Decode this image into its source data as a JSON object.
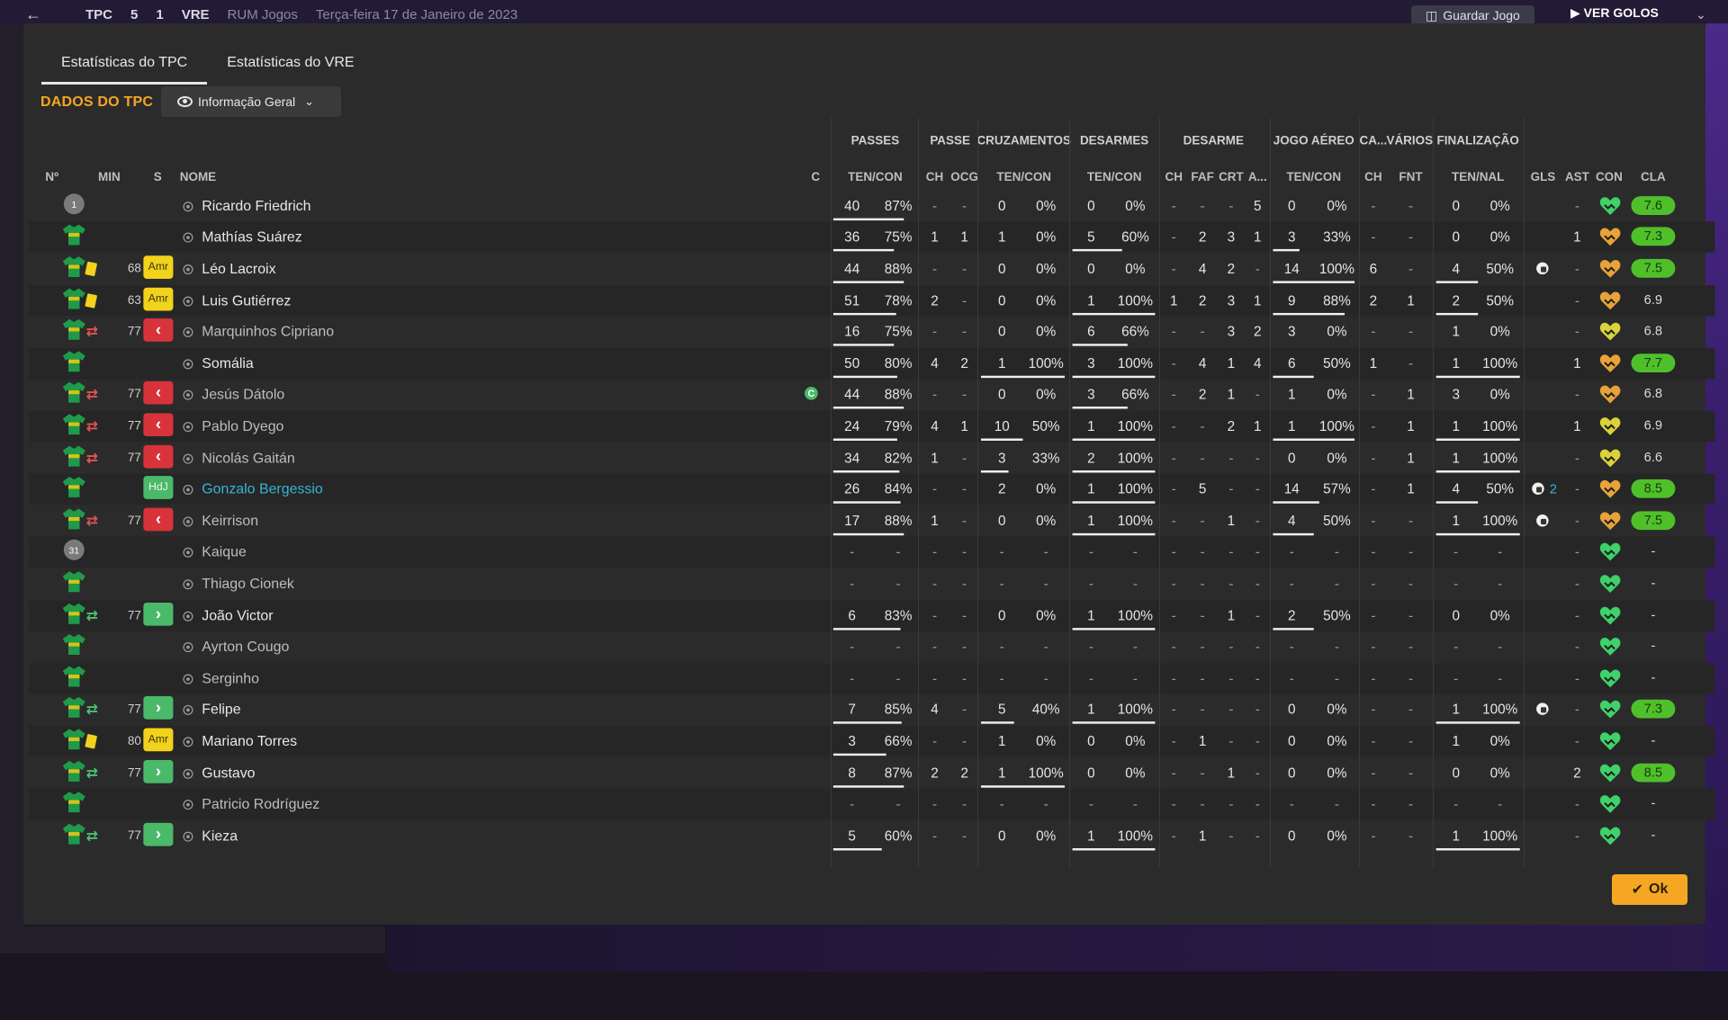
{
  "background": {
    "match_score": [
      "TPC",
      "5",
      "1",
      "VRE"
    ],
    "status": "RUM Jogos",
    "date": "Terça-feira 17 de Janeiro de 2023",
    "save_label": "Guardar Jogo",
    "goals_label": "VER GOLOS"
  },
  "tabs": [
    "Estatísticas do TPC",
    "Estatísticas do VRE"
  ],
  "section_title": "DADOS DO TPC",
  "view_dropdown": "Informação Geral",
  "group_headers": [
    "PASSES",
    "PASSE",
    "CRUZAMENTOS",
    "DESARMES",
    "DESARME",
    "JOGO AÉREO",
    "CA...",
    "VÁRIOS",
    "FINALIZAÇÃO"
  ],
  "col_headers": {
    "num": "Nº",
    "min": "MIN",
    "s": "S",
    "name": "NOME",
    "c": "C",
    "passes": "TEN/CON",
    "ch1": "CH",
    "ocg": "OCG",
    "cruz": "TEN/CON",
    "des": "TEN/CON",
    "ch2": "CH",
    "faf": "FAF",
    "crt": "CRT",
    "a": "A...",
    "aereo": "TEN/CON",
    "ch3": "CH",
    "fnt": "FNT",
    "fin": "TEN/NAL",
    "gls": "GLS",
    "ast": "AST",
    "con": "CON",
    "cla": "CLA"
  },
  "ok_label": "Ok",
  "colors": {
    "accent": "#f5a623",
    "rating_high": "#4fc02a",
    "sub_out": "#d8333a",
    "sub_in": "#4ab96a",
    "potm": "#35b5d5"
  },
  "players": [
    {
      "shirt": "gk",
      "num": "1",
      "icon": "",
      "min": "",
      "s": "",
      "name": "Ricardo Friedrich",
      "style": "",
      "c": "",
      "p": [
        "40",
        "87%"
      ],
      "ch1": "-",
      "ocg": "-",
      "cz": [
        "0",
        "0%"
      ],
      "ds": [
        "0",
        "0%"
      ],
      "ch2": "-",
      "faf": "-",
      "crt": "-",
      "a": "5",
      "ae": [
        "0",
        "0%"
      ],
      "ch3": "-",
      "fnt": "-",
      "fn": [
        "0",
        "0%"
      ],
      "gls": "",
      "ast": "-",
      "heart": "green",
      "cla": "7.6"
    },
    {
      "shirt": "out",
      "num": "",
      "icon": "",
      "min": "",
      "s": "",
      "name": "Mathías Suárez",
      "style": "",
      "c": "",
      "p": [
        "36",
        "75%"
      ],
      "ch1": "1",
      "ocg": "1",
      "cz": [
        "1",
        "0%"
      ],
      "ds": [
        "5",
        "60%"
      ],
      "ch2": "-",
      "faf": "2",
      "crt": "3",
      "a": "1",
      "ae": [
        "3",
        "33%"
      ],
      "ch3": "-",
      "fnt": "-",
      "fn": [
        "0",
        "0%"
      ],
      "gls": "",
      "ast": "1",
      "heart": "orange",
      "cla": "7.3"
    },
    {
      "shirt": "out",
      "num": "",
      "icon": "card",
      "min": "68",
      "s": "Amr",
      "name": "Léo Lacroix",
      "style": "",
      "c": "",
      "p": [
        "44",
        "88%"
      ],
      "ch1": "-",
      "ocg": "-",
      "cz": [
        "0",
        "0%"
      ],
      "ds": [
        "0",
        "0%"
      ],
      "ch2": "-",
      "faf": "4",
      "crt": "2",
      "a": "-",
      "ae": [
        "14",
        "100%"
      ],
      "ch3": "6",
      "fnt": "-",
      "fn": [
        "4",
        "50%"
      ],
      "gls": "ball",
      "ast": "-",
      "heart": "orange",
      "cla": "7.5"
    },
    {
      "shirt": "out",
      "num": "",
      "icon": "card",
      "min": "63",
      "s": "Amr",
      "name": "Luis Gutiérrez",
      "style": "",
      "c": "",
      "p": [
        "51",
        "78%"
      ],
      "ch1": "2",
      "ocg": "-",
      "cz": [
        "0",
        "0%"
      ],
      "ds": [
        "1",
        "100%"
      ],
      "ch2": "1",
      "faf": "2",
      "crt": "3",
      "a": "1",
      "ae": [
        "9",
        "88%"
      ],
      "ch3": "2",
      "fnt": "1",
      "fn": [
        "2",
        "50%"
      ],
      "gls": "",
      "ast": "-",
      "heart": "orange",
      "cla": "6.9"
    },
    {
      "shirt": "out",
      "num": "",
      "icon": "out",
      "min": "77",
      "s": "out",
      "name": "Marquinhos Cipriano",
      "style": "sub",
      "c": "",
      "p": [
        "16",
        "75%"
      ],
      "ch1": "-",
      "ocg": "-",
      "cz": [
        "0",
        "0%"
      ],
      "ds": [
        "6",
        "66%"
      ],
      "ch2": "-",
      "faf": "-",
      "crt": "3",
      "a": "2",
      "ae": [
        "3",
        "0%"
      ],
      "ch3": "-",
      "fnt": "-",
      "fn": [
        "1",
        "0%"
      ],
      "gls": "",
      "ast": "-",
      "heart": "yellow",
      "cla": "6.8"
    },
    {
      "shirt": "out",
      "num": "",
      "icon": "",
      "min": "",
      "s": "",
      "name": "Somália",
      "style": "",
      "c": "",
      "p": [
        "50",
        "80%"
      ],
      "ch1": "4",
      "ocg": "2",
      "cz": [
        "1",
        "100%"
      ],
      "ds": [
        "3",
        "100%"
      ],
      "ch2": "-",
      "faf": "4",
      "crt": "1",
      "a": "4",
      "ae": [
        "6",
        "50%"
      ],
      "ch3": "1",
      "fnt": "-",
      "fn": [
        "1",
        "100%"
      ],
      "gls": "",
      "ast": "1",
      "heart": "orange",
      "cla": "7.7"
    },
    {
      "shirt": "out",
      "num": "",
      "icon": "out",
      "min": "77",
      "s": "out",
      "name": "Jesús Dátolo",
      "style": "sub",
      "c": "C",
      "p": [
        "44",
        "88%"
      ],
      "ch1": "-",
      "ocg": "-",
      "cz": [
        "0",
        "0%"
      ],
      "ds": [
        "3",
        "66%"
      ],
      "ch2": "-",
      "faf": "2",
      "crt": "1",
      "a": "-",
      "ae": [
        "1",
        "0%"
      ],
      "ch3": "-",
      "fnt": "1",
      "fn": [
        "3",
        "0%"
      ],
      "gls": "",
      "ast": "-",
      "heart": "orange",
      "cla": "6.8"
    },
    {
      "shirt": "out",
      "num": "",
      "icon": "out",
      "min": "77",
      "s": "out",
      "name": "Pablo Dyego",
      "style": "sub",
      "c": "",
      "p": [
        "24",
        "79%"
      ],
      "ch1": "4",
      "ocg": "1",
      "cz": [
        "10",
        "50%"
      ],
      "ds": [
        "1",
        "100%"
      ],
      "ch2": "-",
      "faf": "-",
      "crt": "2",
      "a": "1",
      "ae": [
        "1",
        "100%"
      ],
      "ch3": "-",
      "fnt": "1",
      "fn": [
        "1",
        "100%"
      ],
      "gls": "",
      "ast": "1",
      "heart": "yellow",
      "cla": "6.9"
    },
    {
      "shirt": "out",
      "num": "",
      "icon": "out",
      "min": "77",
      "s": "out",
      "name": "Nicolás Gaitán",
      "style": "sub",
      "c": "",
      "p": [
        "34",
        "82%"
      ],
      "ch1": "1",
      "ocg": "-",
      "cz": [
        "3",
        "33%"
      ],
      "ds": [
        "2",
        "100%"
      ],
      "ch2": "-",
      "faf": "-",
      "crt": "-",
      "a": "-",
      "ae": [
        "0",
        "0%"
      ],
      "ch3": "-",
      "fnt": "1",
      "fn": [
        "1",
        "100%"
      ],
      "gls": "",
      "ast": "-",
      "heart": "yellow",
      "cla": "6.6"
    },
    {
      "shirt": "out",
      "num": "",
      "icon": "",
      "min": "",
      "s": "HdJ",
      "name": "Gonzalo Bergessio",
      "style": "potm",
      "c": "",
      "p": [
        "26",
        "84%"
      ],
      "ch1": "-",
      "ocg": "-",
      "cz": [
        "2",
        "0%"
      ],
      "ds": [
        "1",
        "100%"
      ],
      "ch2": "-",
      "faf": "5",
      "crt": "-",
      "a": "-",
      "ae": [
        "14",
        "57%"
      ],
      "ch3": "-",
      "fnt": "1",
      "fn": [
        "4",
        "50%"
      ],
      "gls": "ball2",
      "ast": "-",
      "heart": "orange",
      "cla": "8.5"
    },
    {
      "shirt": "out",
      "num": "",
      "icon": "out",
      "min": "77",
      "s": "out",
      "name": "Keirrison",
      "style": "sub",
      "c": "",
      "p": [
        "17",
        "88%"
      ],
      "ch1": "1",
      "ocg": "-",
      "cz": [
        "0",
        "0%"
      ],
      "ds": [
        "1",
        "100%"
      ],
      "ch2": "-",
      "faf": "-",
      "crt": "1",
      "a": "-",
      "ae": [
        "4",
        "50%"
      ],
      "ch3": "-",
      "fnt": "-",
      "fn": [
        "1",
        "100%"
      ],
      "gls": "ball",
      "ast": "-",
      "heart": "orange",
      "cla": "7.5"
    },
    {
      "shirt": "gk",
      "num": "31",
      "icon": "",
      "min": "",
      "s": "",
      "name": "Kaique",
      "style": "sub",
      "c": "",
      "p": [
        "-",
        "-"
      ],
      "ch1": "-",
      "ocg": "-",
      "cz": [
        "-",
        "-"
      ],
      "ds": [
        "-",
        "-"
      ],
      "ch2": "-",
      "faf": "-",
      "crt": "-",
      "a": "-",
      "ae": [
        "-",
        "-"
      ],
      "ch3": "-",
      "fnt": "-",
      "fn": [
        "-",
        "-"
      ],
      "gls": "",
      "ast": "-",
      "heart": "green",
      "cla": "-"
    },
    {
      "shirt": "out",
      "num": "",
      "icon": "",
      "min": "",
      "s": "",
      "name": "Thiago Cionek",
      "style": "sub",
      "c": "",
      "p": [
        "-",
        "-"
      ],
      "ch1": "-",
      "ocg": "-",
      "cz": [
        "-",
        "-"
      ],
      "ds": [
        "-",
        "-"
      ],
      "ch2": "-",
      "faf": "-",
      "crt": "-",
      "a": "-",
      "ae": [
        "-",
        "-"
      ],
      "ch3": "-",
      "fnt": "-",
      "fn": [
        "-",
        "-"
      ],
      "gls": "",
      "ast": "-",
      "heart": "green",
      "cla": "-"
    },
    {
      "shirt": "out",
      "num": "",
      "icon": "in",
      "min": "77",
      "s": "in",
      "name": "João Victor",
      "style": "",
      "c": "",
      "p": [
        "6",
        "83%"
      ],
      "ch1": "-",
      "ocg": "-",
      "cz": [
        "0",
        "0%"
      ],
      "ds": [
        "1",
        "100%"
      ],
      "ch2": "-",
      "faf": "-",
      "crt": "1",
      "a": "-",
      "ae": [
        "2",
        "50%"
      ],
      "ch3": "-",
      "fnt": "-",
      "fn": [
        "0",
        "0%"
      ],
      "gls": "",
      "ast": "-",
      "heart": "green",
      "cla": "-"
    },
    {
      "shirt": "out",
      "num": "",
      "icon": "",
      "min": "",
      "s": "",
      "name": "Ayrton Cougo",
      "style": "sub",
      "c": "",
      "p": [
        "-",
        "-"
      ],
      "ch1": "-",
      "ocg": "-",
      "cz": [
        "-",
        "-"
      ],
      "ds": [
        "-",
        "-"
      ],
      "ch2": "-",
      "faf": "-",
      "crt": "-",
      "a": "-",
      "ae": [
        "-",
        "-"
      ],
      "ch3": "-",
      "fnt": "-",
      "fn": [
        "-",
        "-"
      ],
      "gls": "",
      "ast": "-",
      "heart": "green",
      "cla": "-"
    },
    {
      "shirt": "out",
      "num": "",
      "icon": "",
      "min": "",
      "s": "",
      "name": "Serginho",
      "style": "sub",
      "c": "",
      "p": [
        "-",
        "-"
      ],
      "ch1": "-",
      "ocg": "-",
      "cz": [
        "-",
        "-"
      ],
      "ds": [
        "-",
        "-"
      ],
      "ch2": "-",
      "faf": "-",
      "crt": "-",
      "a": "-",
      "ae": [
        "-",
        "-"
      ],
      "ch3": "-",
      "fnt": "-",
      "fn": [
        "-",
        "-"
      ],
      "gls": "",
      "ast": "-",
      "heart": "green",
      "cla": "-"
    },
    {
      "shirt": "out",
      "num": "",
      "icon": "in",
      "min": "77",
      "s": "in",
      "name": "Felipe",
      "style": "",
      "c": "",
      "p": [
        "7",
        "85%"
      ],
      "ch1": "4",
      "ocg": "-",
      "cz": [
        "5",
        "40%"
      ],
      "ds": [
        "1",
        "100%"
      ],
      "ch2": "-",
      "faf": "-",
      "crt": "-",
      "a": "-",
      "ae": [
        "0",
        "0%"
      ],
      "ch3": "-",
      "fnt": "-",
      "fn": [
        "1",
        "100%"
      ],
      "gls": "ball",
      "ast": "-",
      "heart": "green",
      "cla": "7.3"
    },
    {
      "shirt": "out",
      "num": "",
      "icon": "card",
      "min": "80",
      "s": "Amr",
      "name": "Mariano Torres",
      "style": "",
      "c": "",
      "p": [
        "3",
        "66%"
      ],
      "ch1": "-",
      "ocg": "-",
      "cz": [
        "1",
        "0%"
      ],
      "ds": [
        "0",
        "0%"
      ],
      "ch2": "-",
      "faf": "1",
      "crt": "-",
      "a": "-",
      "ae": [
        "0",
        "0%"
      ],
      "ch3": "-",
      "fnt": "-",
      "fn": [
        "1",
        "0%"
      ],
      "gls": "",
      "ast": "-",
      "heart": "green",
      "cla": "-"
    },
    {
      "shirt": "out",
      "num": "",
      "icon": "in",
      "min": "77",
      "s": "in",
      "name": "Gustavo",
      "style": "",
      "c": "",
      "p": [
        "8",
        "87%"
      ],
      "ch1": "2",
      "ocg": "2",
      "cz": [
        "1",
        "100%"
      ],
      "ds": [
        "0",
        "0%"
      ],
      "ch2": "-",
      "faf": "-",
      "crt": "1",
      "a": "-",
      "ae": [
        "0",
        "0%"
      ],
      "ch3": "-",
      "fnt": "-",
      "fn": [
        "0",
        "0%"
      ],
      "gls": "",
      "ast": "2",
      "heart": "green",
      "cla": "8.5"
    },
    {
      "shirt": "out",
      "num": "",
      "icon": "",
      "min": "",
      "s": "",
      "name": "Patricio Rodríguez",
      "style": "sub",
      "c": "",
      "p": [
        "-",
        "-"
      ],
      "ch1": "-",
      "ocg": "-",
      "cz": [
        "-",
        "-"
      ],
      "ds": [
        "-",
        "-"
      ],
      "ch2": "-",
      "faf": "-",
      "crt": "-",
      "a": "-",
      "ae": [
        "-",
        "-"
      ],
      "ch3": "-",
      "fnt": "-",
      "fn": [
        "-",
        "-"
      ],
      "gls": "",
      "ast": "-",
      "heart": "green",
      "cla": "-"
    },
    {
      "shirt": "out",
      "num": "",
      "icon": "in",
      "min": "77",
      "s": "in",
      "name": "Kieza",
      "style": "",
      "c": "",
      "p": [
        "5",
        "60%"
      ],
      "ch1": "-",
      "ocg": "-",
      "cz": [
        "0",
        "0%"
      ],
      "ds": [
        "1",
        "100%"
      ],
      "ch2": "-",
      "faf": "1",
      "crt": "-",
      "a": "-",
      "ae": [
        "0",
        "0%"
      ],
      "ch3": "-",
      "fnt": "-",
      "fn": [
        "1",
        "100%"
      ],
      "gls": "",
      "ast": "-",
      "heart": "green",
      "cla": "-"
    }
  ]
}
